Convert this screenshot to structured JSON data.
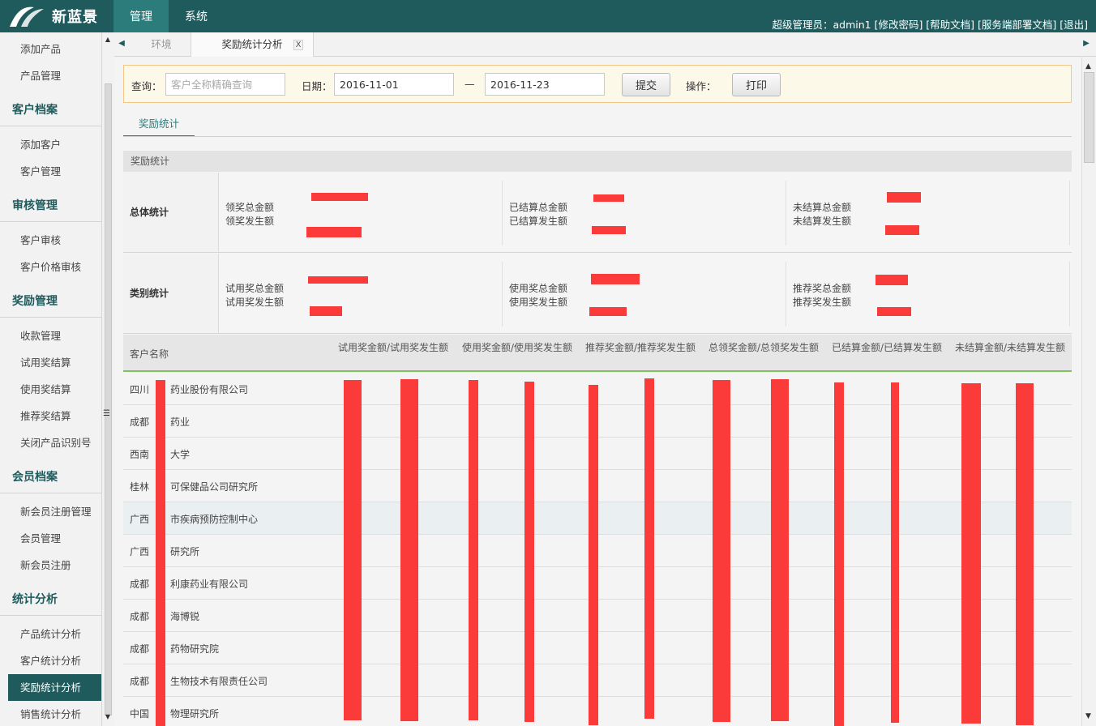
{
  "app": {
    "brand": "新蓝景"
  },
  "topnav": [
    {
      "label": "管理"
    },
    {
      "label": "系统"
    }
  ],
  "toplinks": "超级管理员：admin1 [修改密码] [帮助文档] [服务端部署文档] [退出]",
  "sidebar": {
    "g0": [
      "添加产品",
      "产品管理"
    ],
    "h1": "客户档案",
    "g1": [
      "添加客户",
      "客户管理"
    ],
    "h2": "审核管理",
    "g2": [
      "客户审核",
      "客户价格审核"
    ],
    "h3": "奖励管理",
    "g3": [
      "收款管理",
      "试用奖结算",
      "使用奖结算",
      "推荐奖结算",
      "关闭产品识别号"
    ],
    "h4": "会员档案",
    "g4": [
      "新会员注册管理",
      "会员管理",
      "新会员注册"
    ],
    "h5": "统计分析",
    "g5": [
      "产品统计分析",
      "客户统计分析",
      "奖励统计分析",
      "销售统计分析"
    ]
  },
  "tabs": {
    "inactive": "环境",
    "current": "奖励统计分析",
    "close": "X"
  },
  "query": {
    "label": "查询：",
    "placeholder": "客户全称精确查询",
    "date_label": "日期：",
    "date_from": "2016-11-01",
    "dash": "—",
    "date_to": "2016-11-23",
    "submit": "提交",
    "op_label": "操作：",
    "print": "打印"
  },
  "subtab": "奖励统计",
  "stats": {
    "head": "奖励统计",
    "overall": {
      "label": "总体统计",
      "c1": [
        "领奖总金额",
        "领奖发生额"
      ],
      "c2": [
        "已结算总金额",
        "已结算发生额"
      ],
      "c3": [
        "未结算总金额",
        "未结算发生额"
      ]
    },
    "category": {
      "label": "类别统计",
      "c1": [
        "试用奖总金额",
        "试用奖发生额"
      ],
      "c2": [
        "使用奖总金额",
        "使用奖发生额"
      ],
      "c3": [
        "推荐奖总金额",
        "推荐奖发生额"
      ]
    }
  },
  "table": {
    "headers": [
      "客户名称",
      "试用奖金额/试用奖发生额",
      "使用奖金额/使用奖发生额",
      "推荐奖金额/推荐奖发生额",
      "总领奖金额/总领奖发生额",
      "已结算金额/已结算发生额",
      "未结算金额/未结算发生额"
    ],
    "rows": [
      "四川",
      "药业股份有限公司",
      "成都",
      "药业",
      "西南",
      "大学",
      "桂林",
      "可保健品公司研究所",
      "广西",
      "市疾病预防控制中心",
      "广西",
      "研究所",
      "成都",
      "利康药业有限公司",
      "成都",
      "海博锐",
      "成都",
      "药物研究院",
      "成都",
      "生物技术有限责任公司",
      "中国",
      "物理研究所"
    ]
  },
  "colors": {
    "primary": "#1f5a5c",
    "accent": "#2c7c7b",
    "redaction": "#fb3a3a"
  }
}
